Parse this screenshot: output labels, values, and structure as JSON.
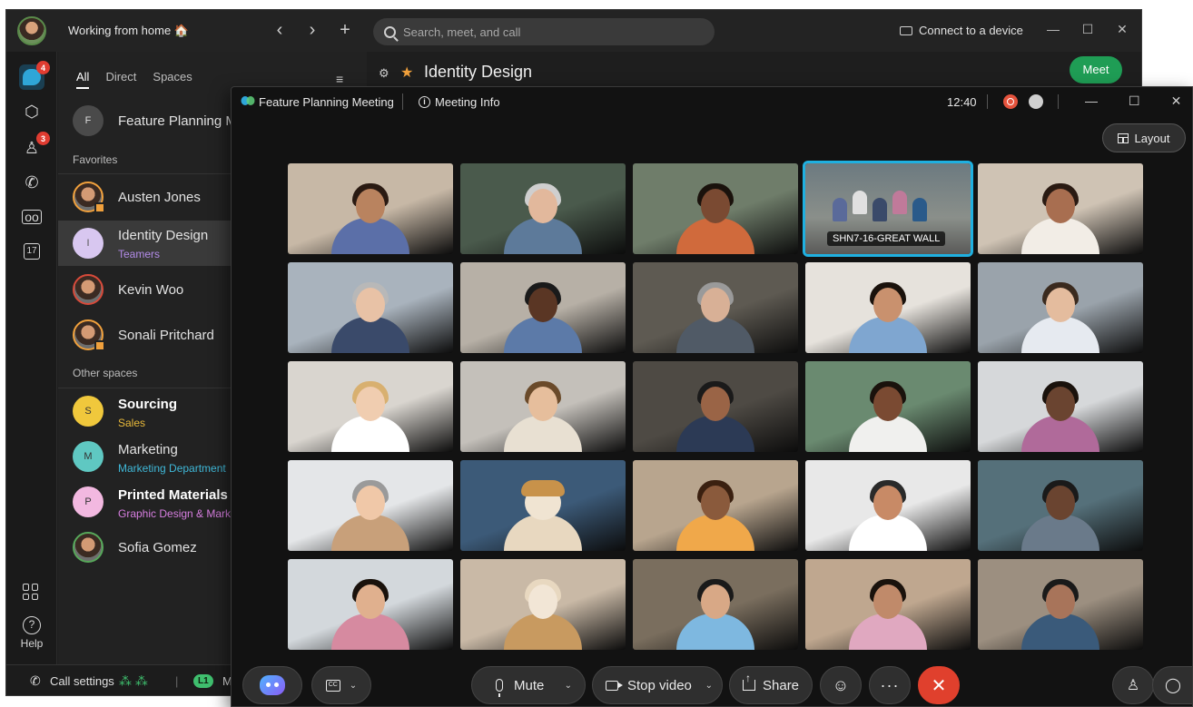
{
  "app": {
    "status": "Working from home 🏠",
    "nav": {
      "back": "‹",
      "forward": "›",
      "new": "+"
    },
    "search_placeholder": "Search, meet, and call",
    "connect_device": "Connect to a device",
    "win_minimize": "—",
    "win_maximize": "☐",
    "win_close": "✕"
  },
  "rail": {
    "messaging_badge": "4",
    "contacts_badge": "3",
    "calendar_day": "17",
    "help_label": "Help"
  },
  "list": {
    "tabs": [
      "All",
      "Direct",
      "Spaces"
    ],
    "pinned": {
      "initial": "F",
      "name": "Feature Planning M"
    },
    "favorites_label": "Favorites",
    "favorites": [
      {
        "name": "Austen Jones"
      },
      {
        "name": "Identity Design",
        "sub": "Teamers",
        "initial": "I"
      },
      {
        "name": "Kevin Woo"
      },
      {
        "name": "Sonali Pritchard"
      }
    ],
    "other_label": "Other spaces",
    "other": [
      {
        "initial": "S",
        "name": "Sourcing",
        "sub": "Sales"
      },
      {
        "initial": "M",
        "name": "Marketing",
        "sub": "Marketing Department"
      },
      {
        "initial": "P",
        "name": "Printed Materials",
        "sub": "Graphic Design & Mark"
      },
      {
        "name": "Sofia Gomez"
      }
    ]
  },
  "space_header": {
    "title": "Identity Design",
    "meet": "Meet"
  },
  "call_settings": {
    "label": "Call settings",
    "line": "L1",
    "suffix": "M"
  },
  "meeting": {
    "title": "Feature Planning Meeting",
    "info": "Meeting Info",
    "time": "12:40",
    "layout": "Layout",
    "controls": {
      "mute": "Mute",
      "stop_video": "Stop video",
      "share": "Share",
      "more": "···",
      "leave": "✕"
    },
    "room_tile_label": "SHN7-16-GREAT WALL"
  },
  "colors": {
    "accent": "#1fb0e0",
    "leave": "#e0402d",
    "meet": "#1f9d55",
    "badge": "#e03c31"
  }
}
